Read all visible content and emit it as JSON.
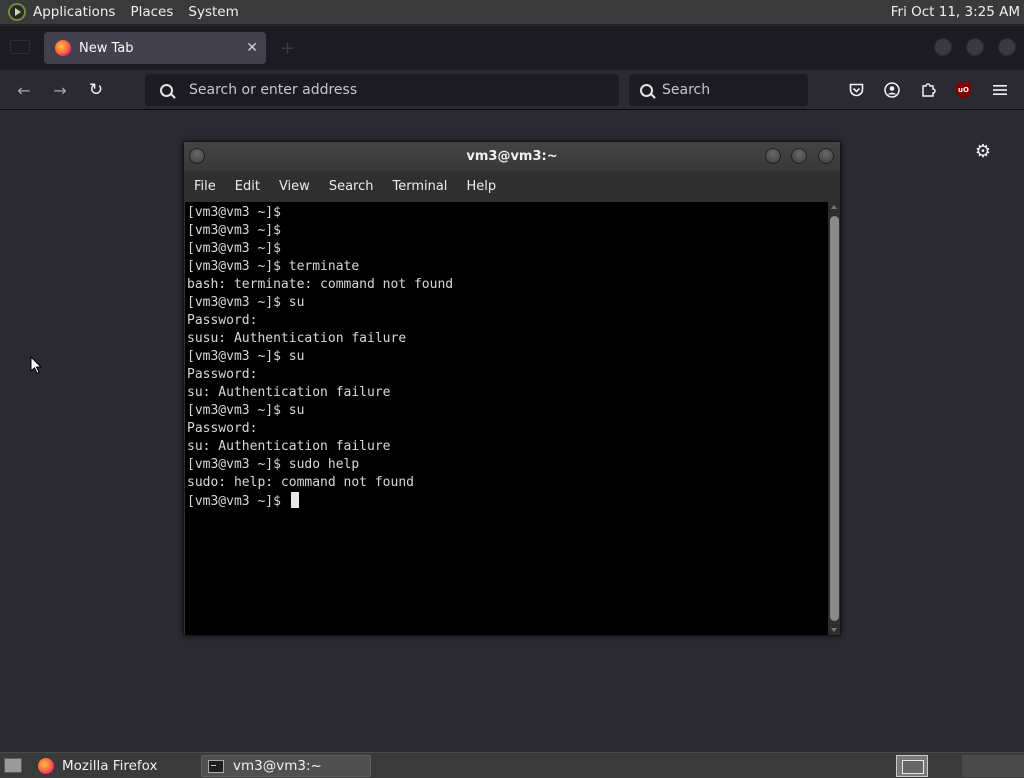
{
  "top_panel": {
    "menus": [
      "Applications",
      "Places",
      "System"
    ],
    "clock": "Fri Oct 11,  3:25 AM"
  },
  "browser": {
    "tab": {
      "title": "New Tab"
    },
    "address_placeholder": "Search or enter address",
    "search_placeholder": "Search",
    "icons": {
      "back": "arrow-left-icon",
      "forward": "arrow-right-icon",
      "reload": "reload-icon",
      "pocket": "pocket-icon",
      "account": "account-icon",
      "extensions": "extensions-icon",
      "ublock": "ublock-origin-icon",
      "menu": "hamburger-menu-icon",
      "settings": "gear-icon"
    },
    "ublock_badge": "uO"
  },
  "terminal": {
    "title": "vm3@vm3:~",
    "menu": [
      "File",
      "Edit",
      "View",
      "Search",
      "Terminal",
      "Help"
    ],
    "lines": [
      "[vm3@vm3 ~]$",
      "[vm3@vm3 ~]$",
      "[vm3@vm3 ~]$",
      "[vm3@vm3 ~]$ terminate",
      "bash: terminate: command not found",
      "[vm3@vm3 ~]$ su",
      "Password:",
      "susu: Authentication failure",
      "[vm3@vm3 ~]$ su",
      "Password:",
      "su: Authentication failure",
      "[vm3@vm3 ~]$ su",
      "Password:",
      "su: Authentication failure",
      "[vm3@vm3 ~]$ sudo help",
      "sudo: help: command not found",
      "[vm3@vm3 ~]$ "
    ]
  },
  "taskbar": {
    "tasks": [
      {
        "label": "Mozilla Firefox",
        "icon": "firefox-icon",
        "active": false
      },
      {
        "label": "vm3@vm3:~",
        "icon": "terminal-icon",
        "active": true
      }
    ]
  }
}
